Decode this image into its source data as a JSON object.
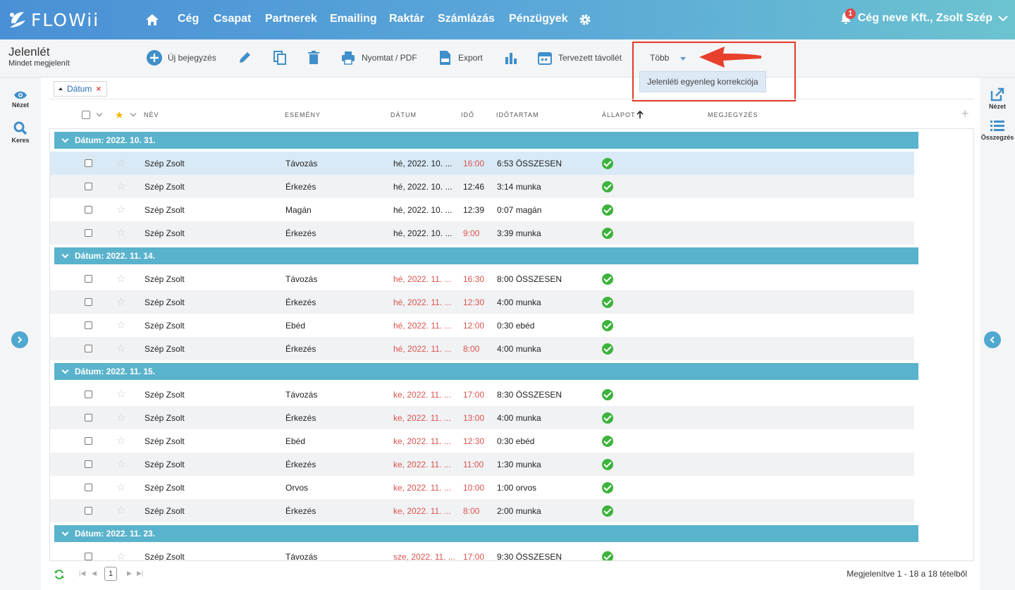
{
  "brand": {
    "name": "FLOWii"
  },
  "nav": {
    "items": [
      "Cég",
      "Csapat",
      "Partnerek",
      "Emailing",
      "Raktár",
      "Számlázás",
      "Pénzügyek"
    ],
    "notifications": "1",
    "account": "Cég neve Kft., Zsolt Szép"
  },
  "page": {
    "title": "Jelenlét",
    "subtitle": "Mindet megjelenít"
  },
  "toolbar": {
    "new_entry": "Új bejegyzés",
    "print": "Nyomtat / PDF",
    "export": "Export",
    "planned_absence": "Tervezett távollét",
    "more": "Több",
    "dropdown_item": "Jelenléti egyenleg korrekciója"
  },
  "left_rail": {
    "view": "Nézet",
    "search": "Keres"
  },
  "right_rail": {
    "view": "Nézet",
    "summary": "Összegzés"
  },
  "filter": {
    "label": "Dátum"
  },
  "columns": {
    "name": "NÉV",
    "event": "ESEMÉNY",
    "date": "DÁTUM",
    "time": "IDŐ",
    "duration": "IDŐTARTAM",
    "status": "ÁLLAPOT",
    "note": "MEGJEGYZÉS"
  },
  "groups": [
    {
      "label": "Dátum: 2022. 10. 31.",
      "rows": [
        {
          "name": "Szép Zsolt",
          "event": "Távozás",
          "date": "hé, 2022. 10. ...",
          "time": "16:00",
          "duration": "6:53 ÖSSZESEN",
          "date_red": false,
          "time_red": true
        },
        {
          "name": "Szép Zsolt",
          "event": "Érkezés",
          "date": "hé, 2022. 10. ...",
          "time": "12:46",
          "duration": "3:14 munka",
          "date_red": false,
          "time_red": false
        },
        {
          "name": "Szép Zsolt",
          "event": "Magán",
          "date": "hé, 2022. 10. ...",
          "time": "12:39",
          "duration": "0:07 magán",
          "date_red": false,
          "time_red": false
        },
        {
          "name": "Szép Zsolt",
          "event": "Érkezés",
          "date": "hé, 2022. 10. ...",
          "time": "9:00",
          "duration": "3:39 munka",
          "date_red": false,
          "time_red": true
        }
      ]
    },
    {
      "label": "Dátum: 2022. 11. 14.",
      "rows": [
        {
          "name": "Szép Zsolt",
          "event": "Távozás",
          "date": "hé, 2022. 11. ...",
          "time": "16:30",
          "duration": "8:00 ÖSSZESEN",
          "date_red": true,
          "time_red": true
        },
        {
          "name": "Szép Zsolt",
          "event": "Érkezés",
          "date": "hé, 2022. 11. ...",
          "time": "12:30",
          "duration": "4:00 munka",
          "date_red": true,
          "time_red": true
        },
        {
          "name": "Szép Zsolt",
          "event": "Ebéd",
          "date": "hé, 2022. 11. ...",
          "time": "12:00",
          "duration": "0:30 ebéd",
          "date_red": true,
          "time_red": true
        },
        {
          "name": "Szép Zsolt",
          "event": "Érkezés",
          "date": "hé, 2022. 11. ...",
          "time": "8:00",
          "duration": "4:00 munka",
          "date_red": true,
          "time_red": true
        }
      ]
    },
    {
      "label": "Dátum: 2022. 11. 15.",
      "rows": [
        {
          "name": "Szép Zsolt",
          "event": "Távozás",
          "date": "ke, 2022. 11. ...",
          "time": "17:00",
          "duration": "8:30 ÖSSZESEN",
          "date_red": true,
          "time_red": true
        },
        {
          "name": "Szép Zsolt",
          "event": "Érkezés",
          "date": "ke, 2022. 11. ...",
          "time": "13:00",
          "duration": "4:00 munka",
          "date_red": true,
          "time_red": true
        },
        {
          "name": "Szép Zsolt",
          "event": "Ebéd",
          "date": "ke, 2022. 11. ...",
          "time": "12:30",
          "duration": "0:30 ebéd",
          "date_red": true,
          "time_red": true
        },
        {
          "name": "Szép Zsolt",
          "event": "Érkezés",
          "date": "ke, 2022. 11. ...",
          "time": "11:00",
          "duration": "1:30 munka",
          "date_red": true,
          "time_red": true
        },
        {
          "name": "Szép Zsolt",
          "event": "Orvos",
          "date": "ke, 2022. 11. ...",
          "time": "10:00",
          "duration": "1:00 orvos",
          "date_red": true,
          "time_red": true
        },
        {
          "name": "Szép Zsolt",
          "event": "Érkezés",
          "date": "ke, 2022. 11. ...",
          "time": "8:00",
          "duration": "2:00 munka",
          "date_red": true,
          "time_red": true
        }
      ]
    },
    {
      "label": "Dátum: 2022. 11. 23.",
      "rows": [
        {
          "name": "Szép Zsolt",
          "event": "Távozás",
          "date": "sze, 2022. 11. ...",
          "time": "17:00",
          "duration": "9:30 ÖSSZESEN",
          "date_red": true,
          "time_red": true
        }
      ]
    }
  ],
  "footer": {
    "page": "1",
    "info": "Megjelenítve 1 - 18 a 18 tételből"
  },
  "colors": {
    "accent": "#5ab3cc",
    "highlight": "#e23a2a",
    "ok": "#3db33d",
    "red_text": "#d9534f"
  }
}
